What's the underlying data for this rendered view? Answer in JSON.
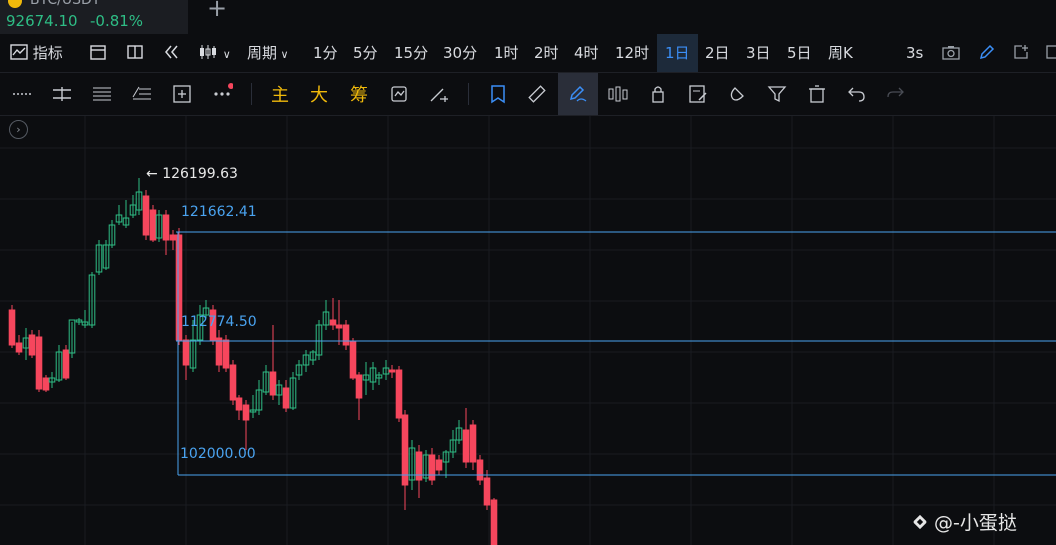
{
  "tab": {
    "symbol": "BTC/USDT",
    "price": "92674.10",
    "change": "-0.81%"
  },
  "toolbar1": {
    "indicators": "指标",
    "period": "周期",
    "intervals": [
      "1分",
      "5分",
      "15分",
      "30分",
      "1时",
      "2时",
      "4时",
      "12时",
      "1日",
      "2日",
      "3日",
      "5日",
      "周K"
    ],
    "active_interval": "1日",
    "refresh": "3s"
  },
  "toolbar2": {
    "main": "主",
    "big": "大",
    "chips": "筹"
  },
  "chart_data": {
    "type": "candlestick",
    "annotations": {
      "high_marker": "126199.63",
      "lines": [
        "121662.41",
        "112774.50",
        "102000.00"
      ]
    },
    "colors": {
      "up": "#2ebd85",
      "down": "#f6465d",
      "line": "#4aa3f0"
    }
  },
  "watermark": {
    "text": "@-小蛋挞"
  }
}
